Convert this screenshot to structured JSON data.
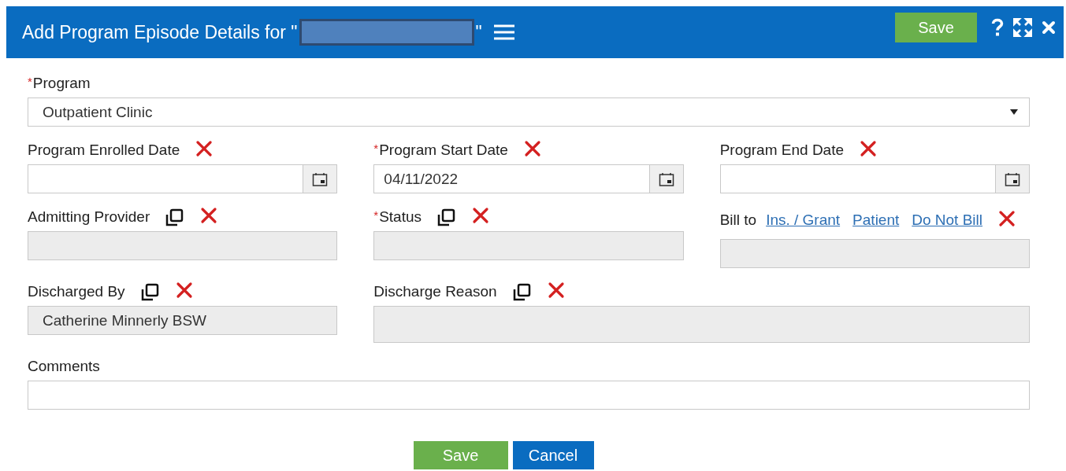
{
  "window": {
    "title_prefix": "Add Program Episode Details for \"",
    "title_suffix": "\"",
    "redacted": true
  },
  "header_buttons": {
    "save": "Save"
  },
  "fields": [
    {
      "kind": "select",
      "label": "Program",
      "required_mark": "*",
      "clearable": false,
      "value": "Outpatient Clinic"
    },
    {
      "kind": "date",
      "label": "Program Enrolled Date",
      "clearable": true
    },
    {
      "kind": "date",
      "label": "Program Start Date",
      "required_mark": "*",
      "clearable": true,
      "value": "04/11/2022"
    },
    {
      "kind": "date",
      "label": "Program End Date",
      "clearable": true
    },
    {
      "kind": "lookup",
      "label": "Admitting Provider",
      "clearable": true
    },
    {
      "kind": "lookup",
      "label": "Status",
      "required_mark": "*",
      "clearable": true
    },
    {
      "kind": "bill",
      "label": "Bill to",
      "clearable": true,
      "links": [
        "Ins. / Grant",
        "Patient",
        "Do Not Bill"
      ]
    },
    {
      "kind": "lookup",
      "label": "Discharged By",
      "clearable": true,
      "value": "Catherine Minnerly BSW"
    },
    {
      "kind": "memo",
      "label": "Discharge Reason",
      "clearable": true
    },
    {
      "kind": "text",
      "label": "Comments",
      "clearable": false
    }
  ],
  "footer_buttons": [
    {
      "kind": "save",
      "label": "Save"
    },
    {
      "kind": "cancel",
      "label": "Cancel"
    }
  ]
}
